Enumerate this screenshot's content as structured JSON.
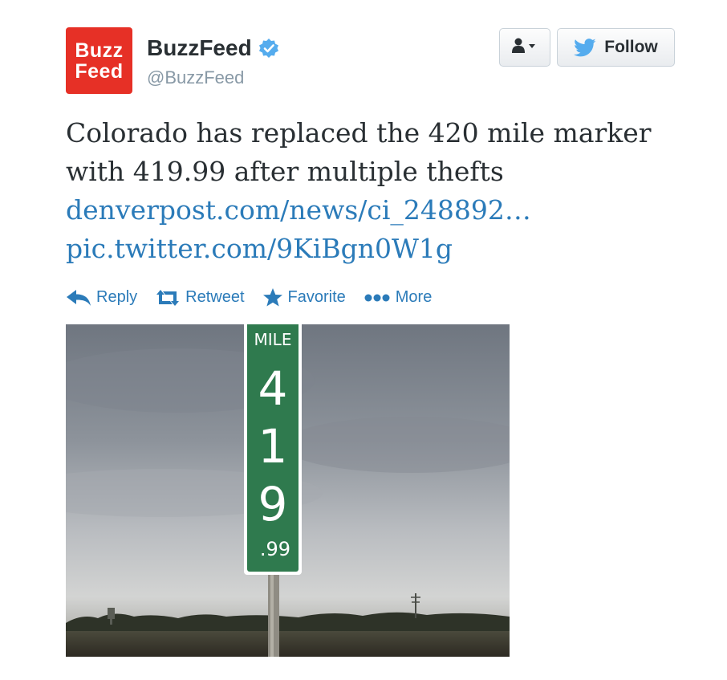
{
  "author": {
    "avatar_line1": "Buzz",
    "avatar_line2": "Feed",
    "name": "BuzzFeed",
    "handle": "@BuzzFeed",
    "verified": true
  },
  "buttons": {
    "user_menu_icon": "person-dropdown-icon",
    "follow_label": "Follow"
  },
  "tweet": {
    "text": "Colorado has replaced the 420 mile marker with 419.99 after multiple thefts",
    "link": "denverpost.com/news/ci_248892…",
    "pic_link": "pic.twitter.com/9KiBgn0W1g"
  },
  "actions": [
    {
      "label": "Reply",
      "icon": "reply-icon"
    },
    {
      "label": "Retweet",
      "icon": "retweet-icon"
    },
    {
      "label": "Favorite",
      "icon": "star-icon"
    },
    {
      "label": "More",
      "icon": "more-dots-icon"
    }
  ],
  "photo": {
    "sign_top": "MILE",
    "sign_digits": [
      "4",
      "1",
      "9"
    ],
    "sign_bottom": ".99"
  },
  "colors": {
    "link": "#2b7bb9",
    "avatar_bg": "#e63026",
    "sign_green": "#2f7a4e"
  }
}
